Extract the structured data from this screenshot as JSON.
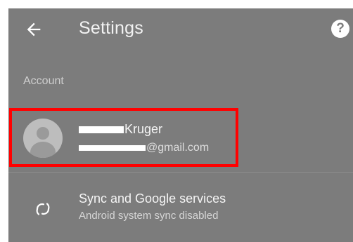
{
  "app_bar": {
    "title": "Settings",
    "back_icon": "arrow-left-icon",
    "help_icon": "help-circle-icon",
    "help_glyph": "?"
  },
  "sections": {
    "account_header": "Account"
  },
  "account": {
    "name_visible": "Kruger",
    "email_visible": "@gmail.com",
    "avatar_icon": "default-avatar-icon"
  },
  "sync": {
    "title": "Sync and Google services",
    "subtitle": "Android system sync disabled",
    "icon": "sync-disabled-icon"
  },
  "colors": {
    "background": "#7c7c7c",
    "highlight": "#ff0000",
    "text_primary": "#f5f5f5"
  }
}
